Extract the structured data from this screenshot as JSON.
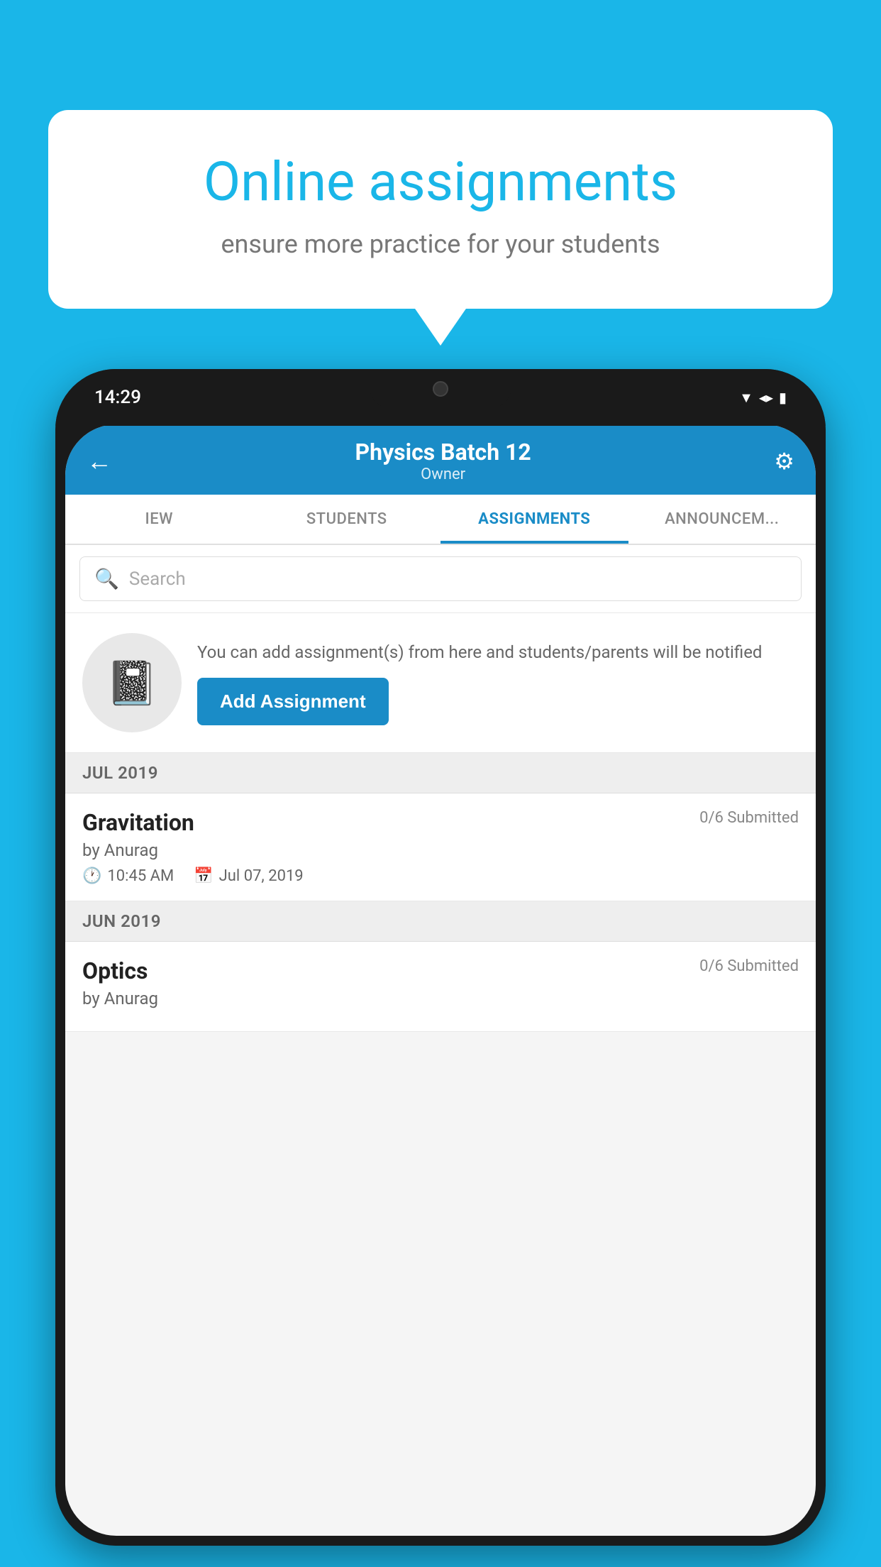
{
  "background_color": "#1ab6e8",
  "speech_bubble": {
    "title": "Online assignments",
    "subtitle": "ensure more practice for your students"
  },
  "phone": {
    "time": "14:29",
    "header": {
      "title": "Physics Batch 12",
      "subtitle": "Owner",
      "back_label": "←",
      "settings_label": "⚙"
    },
    "tabs": [
      {
        "label": "IEW",
        "active": false
      },
      {
        "label": "STUDENTS",
        "active": false
      },
      {
        "label": "ASSIGNMENTS",
        "active": true
      },
      {
        "label": "ANNOUNCEM...",
        "active": false
      }
    ],
    "search": {
      "placeholder": "Search"
    },
    "promo": {
      "description": "You can add assignment(s) from here and students/parents will be notified",
      "button_label": "Add Assignment"
    },
    "sections": [
      {
        "month": "JUL 2019",
        "assignments": [
          {
            "title": "Gravitation",
            "submitted": "0/6 Submitted",
            "author": "by Anurag",
            "time": "10:45 AM",
            "date": "Jul 07, 2019"
          }
        ]
      },
      {
        "month": "JUN 2019",
        "assignments": [
          {
            "title": "Optics",
            "submitted": "0/6 Submitted",
            "author": "by Anurag",
            "time": "",
            "date": ""
          }
        ]
      }
    ]
  }
}
